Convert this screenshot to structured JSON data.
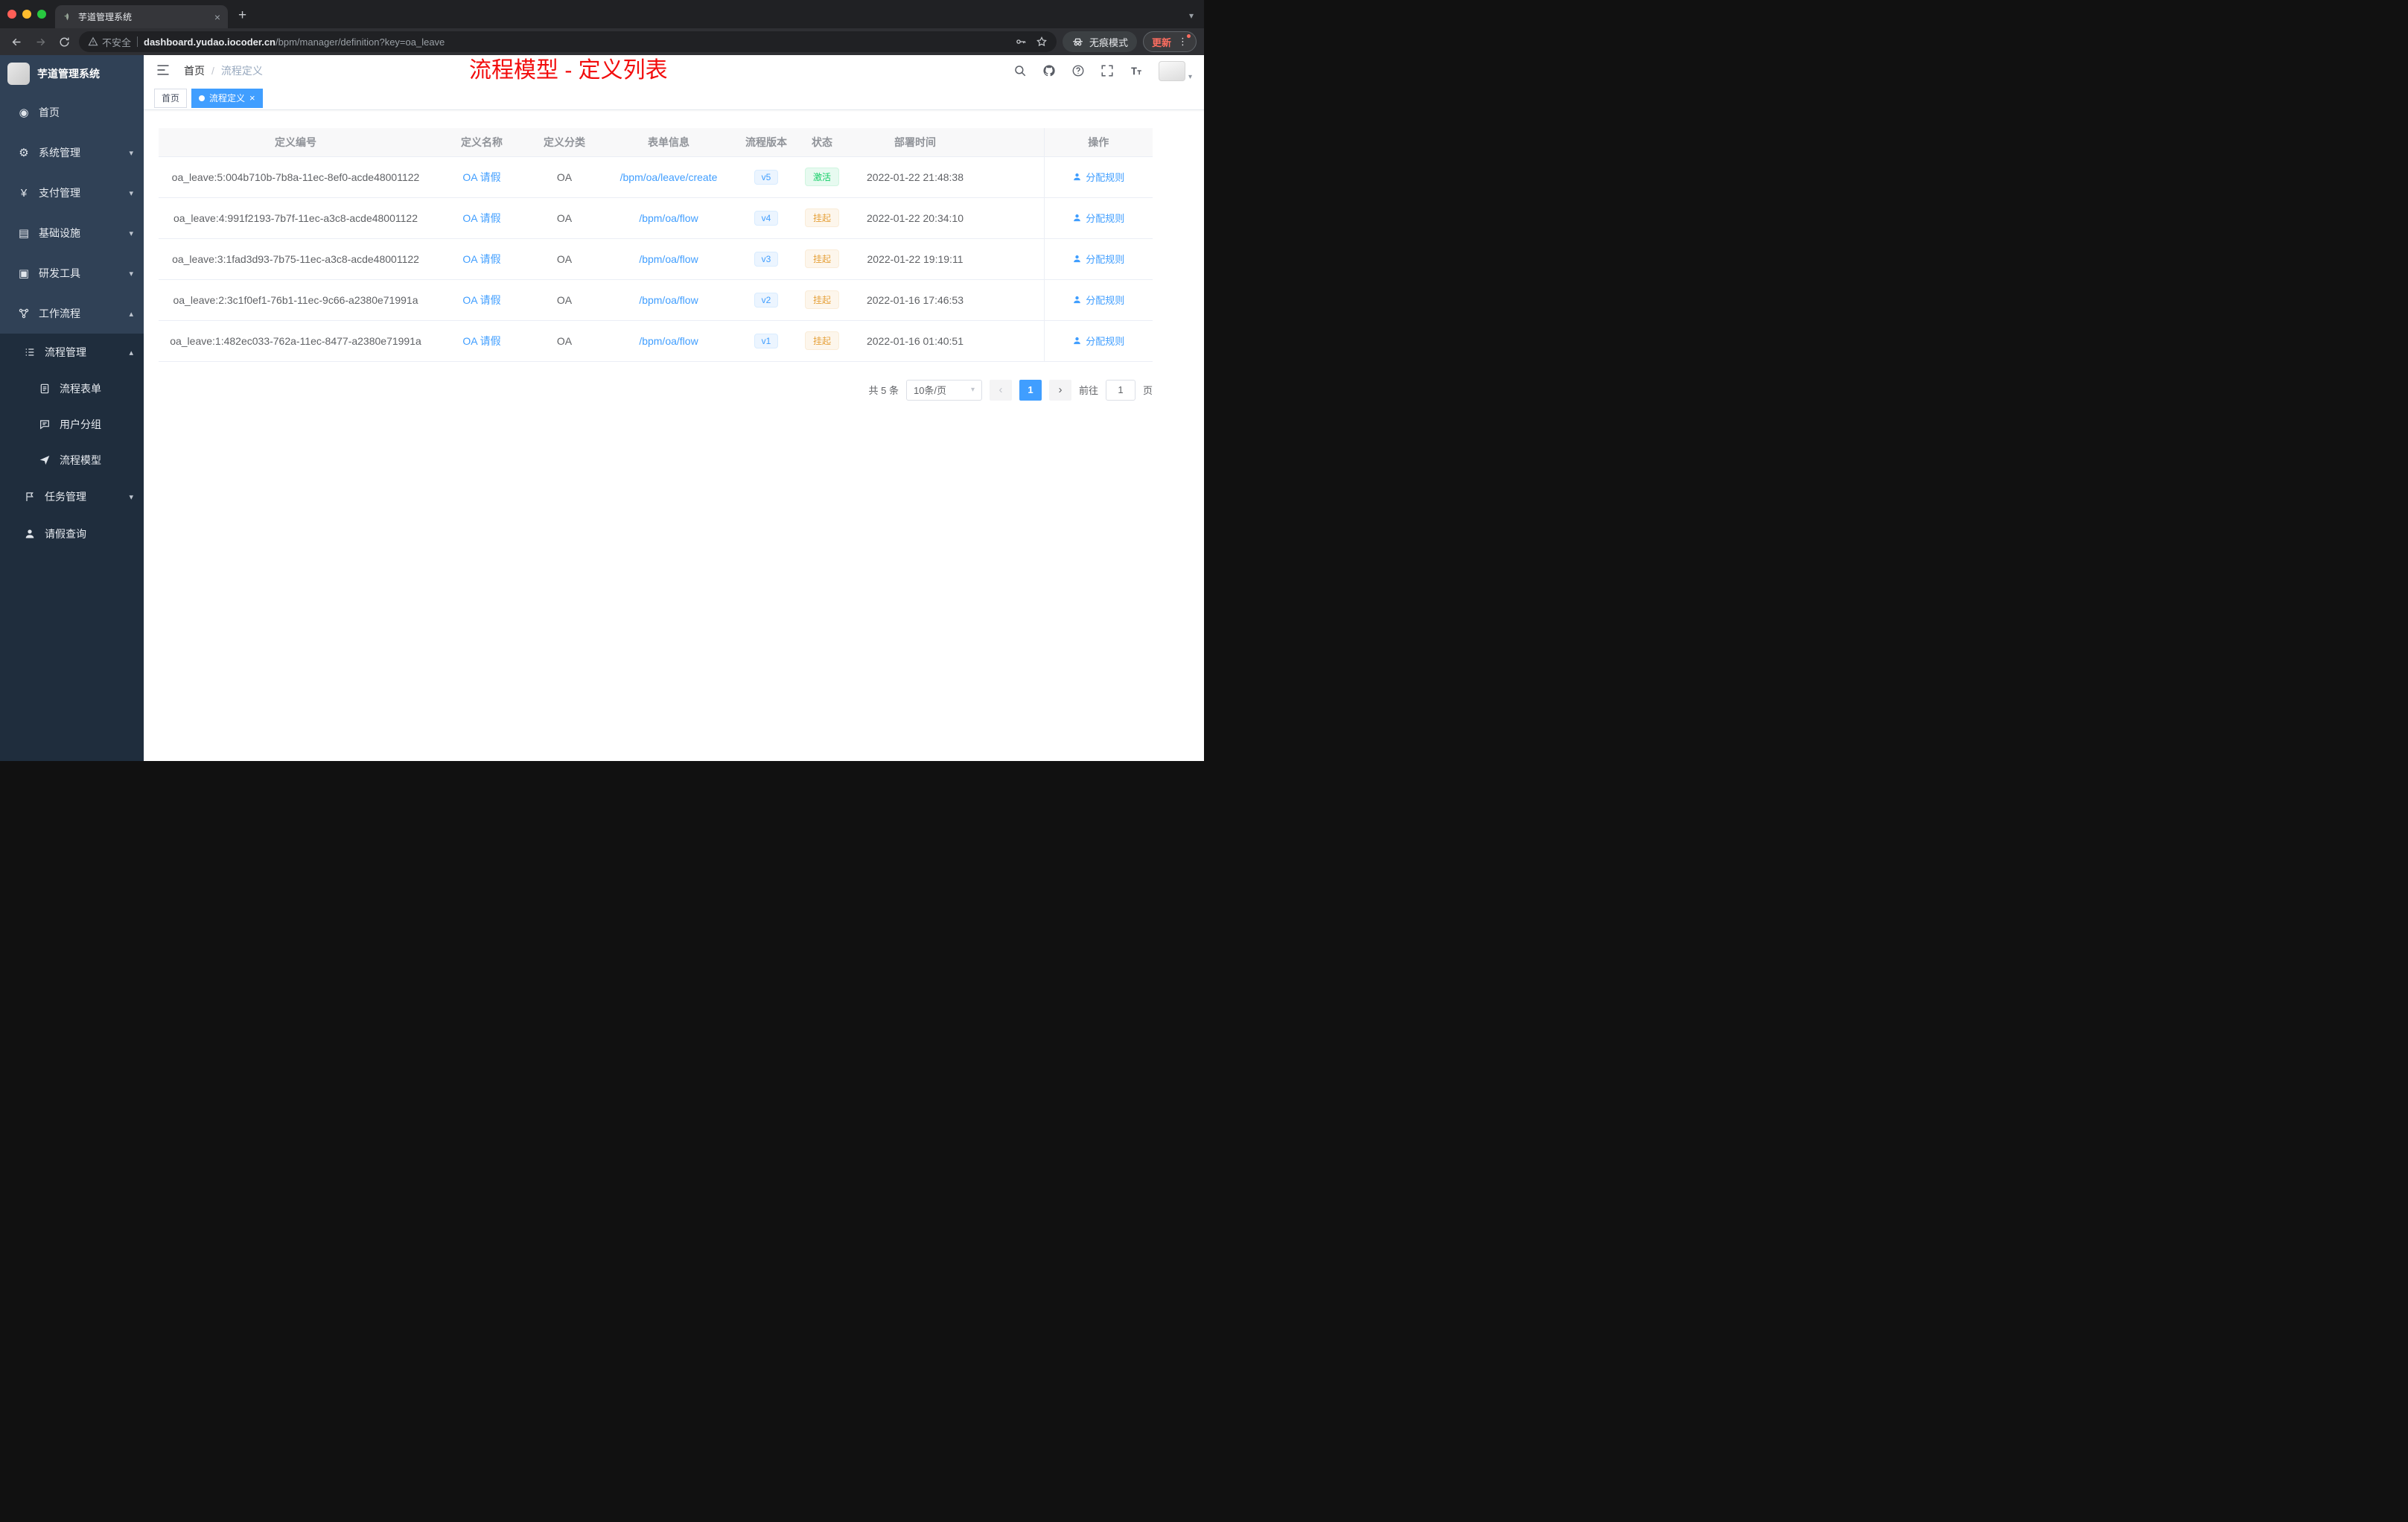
{
  "browser": {
    "tab_title": "芋道管理系统",
    "security_label": "不安全",
    "url_host": "dashboard.yudao.iocoder.cn",
    "url_path": "/bpm/manager/definition?key=oa_leave",
    "incognito_label": "无痕模式",
    "update_label": "更新"
  },
  "sidebar": {
    "app_title": "芋道管理系统",
    "menu": [
      {
        "label": "首页"
      },
      {
        "label": "系统管理"
      },
      {
        "label": "支付管理"
      },
      {
        "label": "基础设施"
      },
      {
        "label": "研发工具"
      },
      {
        "label": "工作流程"
      },
      {
        "label": "流程管理"
      },
      {
        "label": "流程表单"
      },
      {
        "label": "用户分组"
      },
      {
        "label": "流程模型"
      },
      {
        "label": "任务管理"
      },
      {
        "label": "请假查询"
      }
    ]
  },
  "header": {
    "breadcrumb": {
      "home": "首页",
      "sep": "/",
      "current": "流程定义"
    },
    "annotation": "流程模型 - 定义列表"
  },
  "tags": [
    {
      "label": "首页",
      "active": false
    },
    {
      "label": "流程定义",
      "active": true
    }
  ],
  "table": {
    "columns": [
      "定义编号",
      "定义名称",
      "定义分类",
      "表单信息",
      "流程版本",
      "状态",
      "部署时间",
      "操作"
    ],
    "rows": [
      {
        "id": "oa_leave:5:004b710b-7b8a-11ec-8ef0-acde48001122",
        "name": "OA 请假",
        "category": "OA",
        "form": "/bpm/oa/leave/create",
        "version": "v5",
        "status": "激活",
        "status_type": "success",
        "time": "2022-01-22 21:48:38",
        "action": "分配规则"
      },
      {
        "id": "oa_leave:4:991f2193-7b7f-11ec-a3c8-acde48001122",
        "name": "OA 请假",
        "category": "OA",
        "form": "/bpm/oa/flow",
        "version": "v4",
        "status": "挂起",
        "status_type": "warning",
        "time": "2022-01-22 20:34:10",
        "action": "分配规则"
      },
      {
        "id": "oa_leave:3:1fad3d93-7b75-11ec-a3c8-acde48001122",
        "name": "OA 请假",
        "category": "OA",
        "form": "/bpm/oa/flow",
        "version": "v3",
        "status": "挂起",
        "status_type": "warning",
        "time": "2022-01-22 19:19:11",
        "action": "分配规则"
      },
      {
        "id": "oa_leave:2:3c1f0ef1-76b1-11ec-9c66-a2380e71991a",
        "name": "OA 请假",
        "category": "OA",
        "form": "/bpm/oa/flow",
        "version": "v2",
        "status": "挂起",
        "status_type": "warning",
        "time": "2022-01-16 17:46:53",
        "action": "分配规则"
      },
      {
        "id": "oa_leave:1:482ec033-762a-11ec-8477-a2380e71991a",
        "name": "OA 请假",
        "category": "OA",
        "form": "/bpm/oa/flow",
        "version": "v1",
        "status": "挂起",
        "status_type": "warning",
        "time": "2022-01-16 01:40:51",
        "action": "分配规则"
      }
    ]
  },
  "pagination": {
    "total": "共 5 条",
    "page_size": "10条/页",
    "current_page": "1",
    "goto_label": "前往",
    "goto_page": "1",
    "page_unit": "页"
  },
  "icons": {
    "search-icon": "magnifier",
    "github-icon": "github-mark-circle",
    "help-icon": "question-circle",
    "fullscreen-icon": "corner-brackets",
    "font-size-icon": "double-T",
    "user-icon": "person-silhouette",
    "warning-icon": "triangle-exclamation",
    "star-icon": "star-outline",
    "key-icon": "key",
    "incognito-icon": "spy-hat",
    "close-icon": "×",
    "plus-icon": "+",
    "chevron-down-icon": "▾",
    "chevron-up-icon": "▴"
  },
  "colors": {
    "accent": "#409eff",
    "success_text": "#13ce66",
    "success_bg": "#e7faf0",
    "warning_text": "#e6a23c",
    "warning_bg": "#fdf6ec",
    "version_bg": "#ecf5ff",
    "annotation_red": "#f20d0d",
    "sidebar_bg": "#304156",
    "submenu_bg": "#1f2d3d",
    "table_header_bg": "#f8f8f9"
  }
}
